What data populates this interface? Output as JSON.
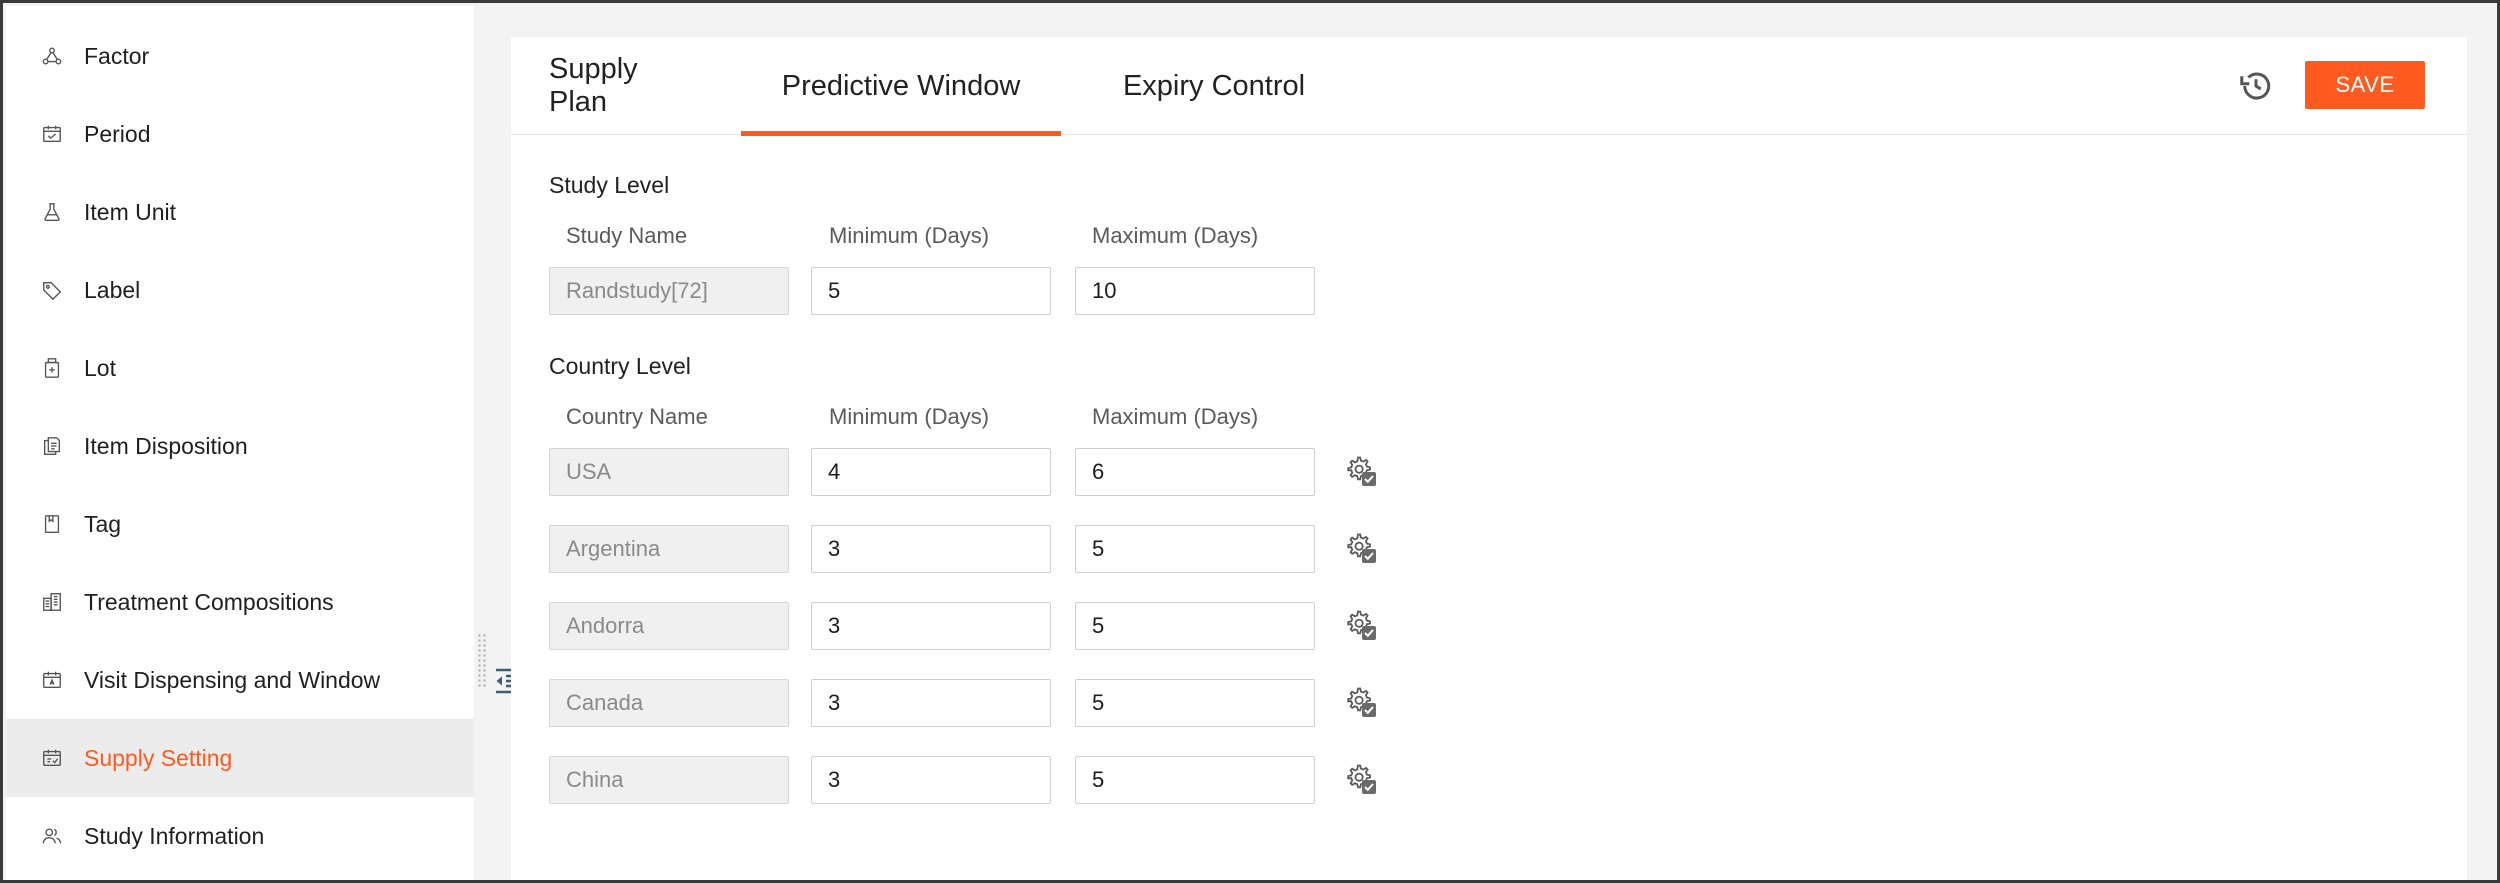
{
  "sidebar": {
    "items": [
      {
        "label": "Factor",
        "icon": "factor-icon"
      },
      {
        "label": "Period",
        "icon": "calendar-icon"
      },
      {
        "label": "Item Unit",
        "icon": "flask-icon"
      },
      {
        "label": "Label",
        "icon": "tag-label-icon"
      },
      {
        "label": "Lot",
        "icon": "bottle-icon"
      },
      {
        "label": "Item Disposition",
        "icon": "documents-icon"
      },
      {
        "label": "Tag",
        "icon": "bookmark-icon"
      },
      {
        "label": "Treatment Compositions",
        "icon": "building-icon"
      },
      {
        "label": "Visit Dispensing and Window",
        "icon": "calendar-person-icon"
      },
      {
        "label": "Supply Setting",
        "icon": "calendar-check-icon",
        "active": true
      },
      {
        "label": "Study Information",
        "icon": "people-icon"
      }
    ]
  },
  "tabs": [
    {
      "label": "Supply Plan"
    },
    {
      "label": "Predictive Window",
      "active": true
    },
    {
      "label": "Expiry Control"
    }
  ],
  "toolbar": {
    "save_label": "SAVE",
    "history_icon": "history-icon"
  },
  "study_level": {
    "title": "Study Level",
    "columns": [
      "Study Name",
      "Minimum (Days)",
      "Maximum (Days)"
    ],
    "row": {
      "name": "Randstudy[72]",
      "min": "5",
      "max": "10"
    }
  },
  "country_level": {
    "title": "Country Level",
    "columns": [
      "Country Name",
      "Minimum (Days)",
      "Maximum (Days)"
    ],
    "rows": [
      {
        "name": "USA",
        "min": "4",
        "max": "6"
      },
      {
        "name": "Argentina",
        "min": "3",
        "max": "5"
      },
      {
        "name": "Andorra",
        "min": "3",
        "max": "5"
      },
      {
        "name": "Canada",
        "min": "3",
        "max": "5"
      },
      {
        "name": "China",
        "min": "3",
        "max": "5"
      }
    ]
  },
  "colors": {
    "accent": "#ff5a1f",
    "active_bg": "#ececec"
  }
}
